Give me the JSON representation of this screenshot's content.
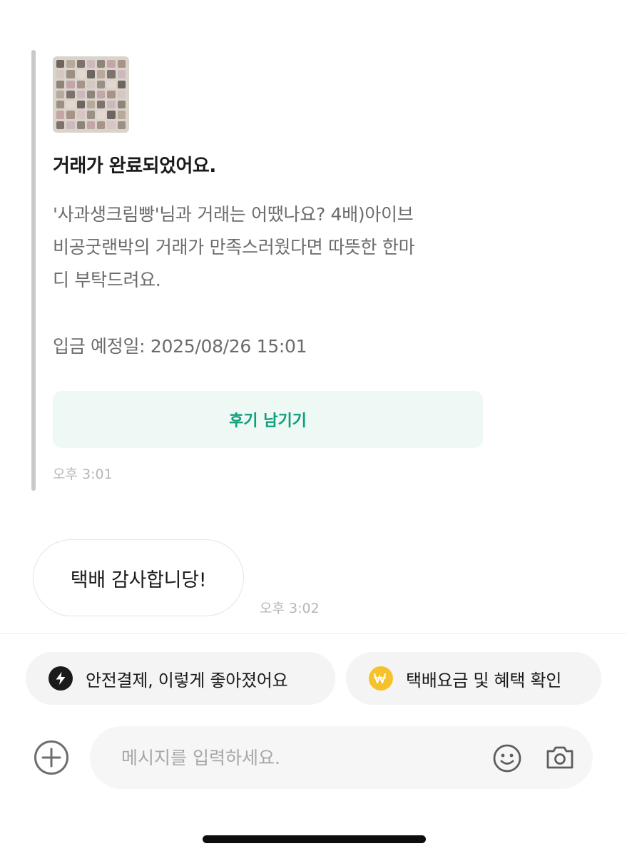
{
  "card": {
    "title": "거래가 완료되었어요.",
    "body_lines": [
      "'사과생크림빵'님과 거래는 어땠나요? 4배)아이브",
      "비공굿랜박의 거래가 만족스러웠다면 따뜻한 한마",
      "디 부탁드려요."
    ],
    "deposit": "입금 예정일: 2025/08/26 15:01",
    "review_button": "후기 남기기",
    "time": "오후 3:01"
  },
  "message": {
    "text": "택배 감사합니당!",
    "time": "오후 3:02"
  },
  "chips": [
    {
      "label": "안전결제, 이렇게 좋아졌어요",
      "icon": "lightning-icon"
    },
    {
      "label": "택배요금 및 혜택 확인",
      "icon": "won-coin-icon"
    }
  ],
  "composer": {
    "placeholder": "메시지를 입력하세요.",
    "icons": [
      "plus-circle-icon",
      "smile-icon",
      "camera-icon"
    ]
  },
  "colors": {
    "accent_green": "#0e9e7a",
    "review_bg": "#eef9f6",
    "coin_yellow": "#f6c12a"
  }
}
